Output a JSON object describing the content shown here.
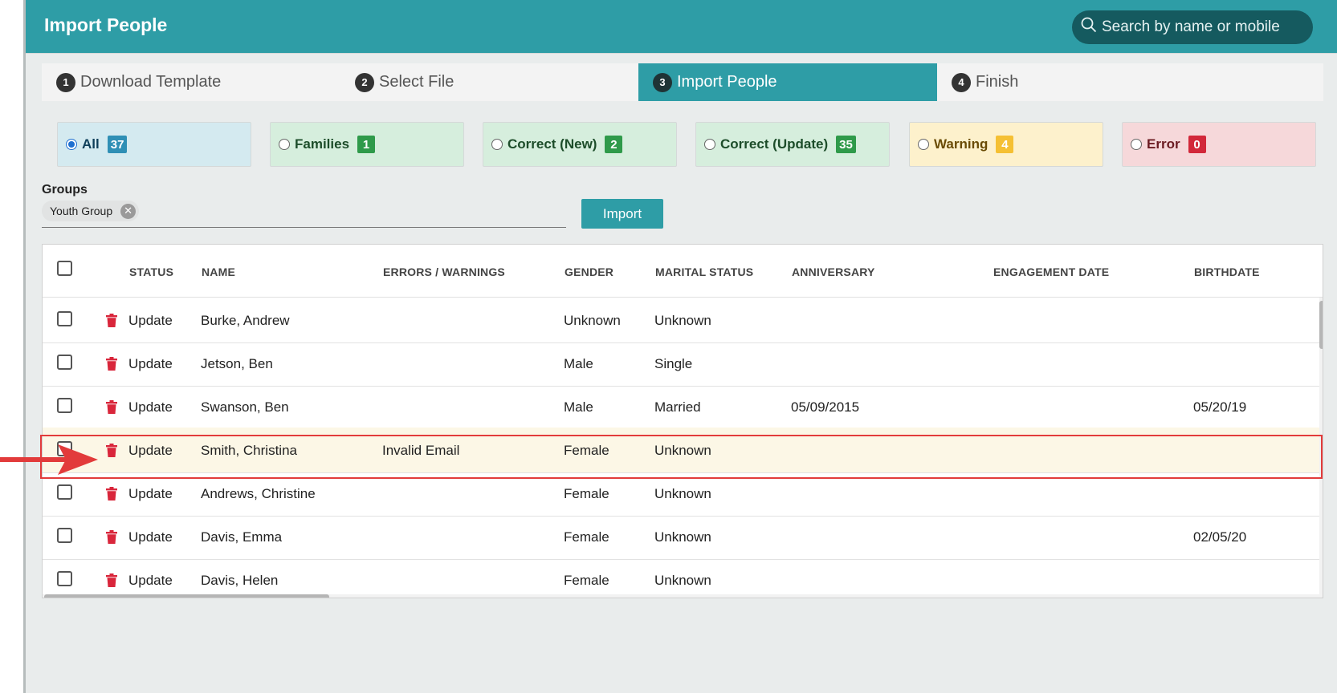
{
  "header": {
    "title": "Import People",
    "search_placeholder": "Search by name or mobile"
  },
  "steps": [
    {
      "num": "1",
      "label": "Download Template",
      "active": false
    },
    {
      "num": "2",
      "label": "Select File",
      "active": false
    },
    {
      "num": "3",
      "label": "Import People",
      "active": true
    },
    {
      "num": "4",
      "label": "Finish",
      "active": false
    }
  ],
  "filters": [
    {
      "label": "All",
      "count": "37",
      "selected": true,
      "bg": "#d4eaf0",
      "badge": "#2f8fb5",
      "text": "#0f3f5a"
    },
    {
      "label": "Families",
      "count": "1",
      "selected": false,
      "bg": "#d6eedd",
      "badge": "#2f9a4a",
      "text": "#1d4d2a"
    },
    {
      "label": "Correct (New)",
      "count": "2",
      "selected": false,
      "bg": "#d6eedd",
      "badge": "#2f9a4a",
      "text": "#1d4d2a"
    },
    {
      "label": "Correct (Update)",
      "count": "35",
      "selected": false,
      "bg": "#d6eedd",
      "badge": "#2f9a4a",
      "text": "#1d4d2a"
    },
    {
      "label": "Warning",
      "count": "4",
      "selected": false,
      "bg": "#fdf1cc",
      "badge": "#f5c033",
      "text": "#6a4c06"
    },
    {
      "label": "Error",
      "count": "0",
      "selected": false,
      "bg": "#f6d8da",
      "badge": "#d2283a",
      "text": "#6b1b22"
    }
  ],
  "groups": {
    "label": "Groups",
    "chips": [
      "Youth Group"
    ],
    "import_label": "Import"
  },
  "table": {
    "columns": [
      "STATUS",
      "NAME",
      "ERRORS / WARNINGS",
      "GENDER",
      "MARITAL STATUS",
      "ANNIVERSARY",
      "ENGAGEMENT DATE",
      "BIRTHDATE"
    ],
    "rows": [
      {
        "status": "Update",
        "name": "Burke, Andrew",
        "errors": "",
        "gender": "Unknown",
        "marital": "Unknown",
        "anniversary": "",
        "engagement": "",
        "birthdate": ""
      },
      {
        "status": "Update",
        "name": "Jetson, Ben",
        "errors": "",
        "gender": "Male",
        "marital": "Single",
        "anniversary": "",
        "engagement": "",
        "birthdate": ""
      },
      {
        "status": "Update",
        "name": "Swanson, Ben",
        "errors": "",
        "gender": "Male",
        "marital": "Married",
        "anniversary": "05/09/2015",
        "engagement": "",
        "birthdate": "05/20/19"
      },
      {
        "status": "Update",
        "name": "Smith, Christina",
        "errors": "Invalid Email",
        "gender": "Female",
        "marital": "Unknown",
        "anniversary": "",
        "engagement": "",
        "birthdate": "",
        "highlight": true
      },
      {
        "status": "Update",
        "name": "Andrews, Christine",
        "errors": "",
        "gender": "Female",
        "marital": "Unknown",
        "anniversary": "",
        "engagement": "",
        "birthdate": ""
      },
      {
        "status": "Update",
        "name": "Davis, Emma",
        "errors": "",
        "gender": "Female",
        "marital": "Unknown",
        "anniversary": "",
        "engagement": "",
        "birthdate": "02/05/20"
      },
      {
        "status": "Update",
        "name": "Davis, Helen",
        "errors": "",
        "gender": "Female",
        "marital": "Unknown",
        "anniversary": "",
        "engagement": "",
        "birthdate": ""
      }
    ]
  },
  "colors": {
    "accent": "#2e9da6",
    "trash": "#d9263b",
    "annotation": "#e23b3b"
  }
}
